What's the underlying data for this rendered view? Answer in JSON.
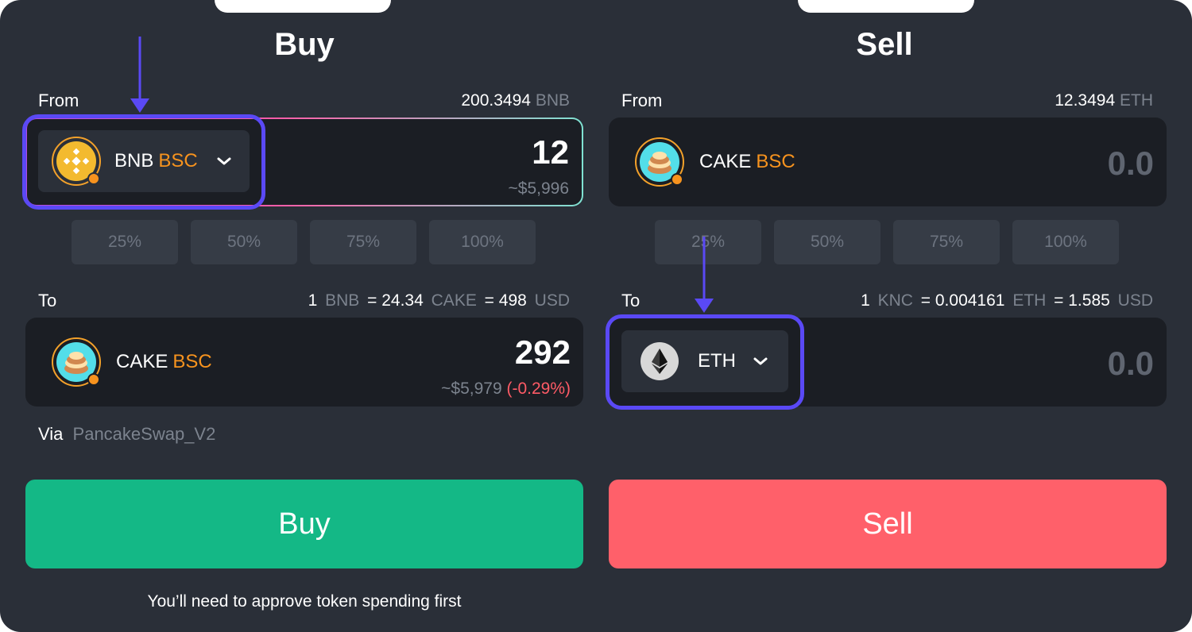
{
  "buy": {
    "title": "Buy",
    "from_label": "From",
    "from_balance_amount": "200.3494",
    "from_balance_unit": "BNB",
    "from_token": "BNB",
    "from_network": "BSC",
    "from_amount": "12",
    "from_usd": "~$5,996",
    "percent_buttons": [
      "25%",
      "50%",
      "75%",
      "100%"
    ],
    "to_label": "To",
    "rate": {
      "a_amount": "1",
      "a_unit": "BNB",
      "eq1": "= 24.34",
      "b_unit": "CAKE",
      "eq2": "= 498",
      "c_unit": "USD"
    },
    "to_token": "CAKE",
    "to_network": "BSC",
    "to_amount": "292",
    "to_usd": "~$5,979",
    "to_change": "(-0.29%)",
    "via_label": "Via",
    "via_value": "PancakeSwap_V2",
    "action_label": "Buy",
    "footnote": "You’ll need to approve token spending first"
  },
  "sell": {
    "title": "Sell",
    "from_label": "From",
    "from_balance_amount": "12.3494",
    "from_balance_unit": "ETH",
    "from_token": "CAKE",
    "from_network": "BSC",
    "from_amount": "0.0",
    "percent_buttons": [
      "25%",
      "50%",
      "75%",
      "100%"
    ],
    "to_label": "To",
    "rate": {
      "a_amount": "1",
      "a_unit": "KNC",
      "eq1": "= 0.004161",
      "b_unit": "ETH",
      "eq2": "= 1.585",
      "c_unit": "USD"
    },
    "to_token": "ETH",
    "to_amount": "0.0",
    "action_label": "Sell"
  },
  "colors": {
    "background": "#2a2f38",
    "buy_button": "#14b886",
    "sell_button": "#ff606a",
    "highlight": "#5a49f5",
    "network": "#f7931e"
  },
  "icons": [
    "bnb-icon",
    "cake-icon",
    "eth-icon",
    "chevron-down-icon",
    "arrow-down-icon"
  ]
}
